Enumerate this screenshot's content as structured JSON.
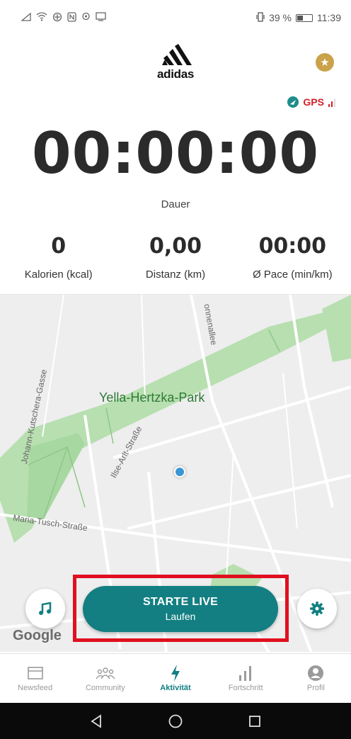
{
  "status_bar": {
    "left_icons": [
      "signal-icon",
      "wifi-icon",
      "data-icon",
      "nfc-icon",
      "location-icon",
      "screen-icon"
    ],
    "vibrate": "vibrate-icon",
    "battery_percent": "39 %",
    "battery_level": 0.39,
    "time": "11:39"
  },
  "header": {
    "brand": "adidas"
  },
  "gps": {
    "label": "GPS"
  },
  "timer": {
    "value": "00:00:00",
    "label": "Dauer"
  },
  "stats": [
    {
      "value": "0",
      "label": "Kalorien (kcal)"
    },
    {
      "value": "0,00",
      "label": "Distanz (km)"
    },
    {
      "value": "00:00",
      "label": "Ø Pace (min/km)"
    }
  ],
  "map": {
    "park_label": "Yella-Hertzka-Park",
    "streets": [
      "Johann-Kutschera-Gasse",
      "Ilse-Arlt-Straße",
      "Maria-Tusch-Straße",
      "onnenallee"
    ],
    "attribution": "Google"
  },
  "start_button": {
    "title": "STARTE LIVE",
    "subtitle": "Laufen"
  },
  "bottom_nav": {
    "items": [
      {
        "label": "Newsfeed",
        "icon": "newsfeed-icon"
      },
      {
        "label": "Community",
        "icon": "community-icon"
      },
      {
        "label": "Aktivität",
        "icon": "activity-icon"
      },
      {
        "label": "Fortschritt",
        "icon": "progress-icon"
      },
      {
        "label": "Profil",
        "icon": "profile-icon"
      }
    ],
    "active_index": 2
  },
  "colors": {
    "accent": "#137f82",
    "gps_red": "#d0202b",
    "park_green": "#b7dfb0",
    "highlight_red": "#e0101f"
  }
}
